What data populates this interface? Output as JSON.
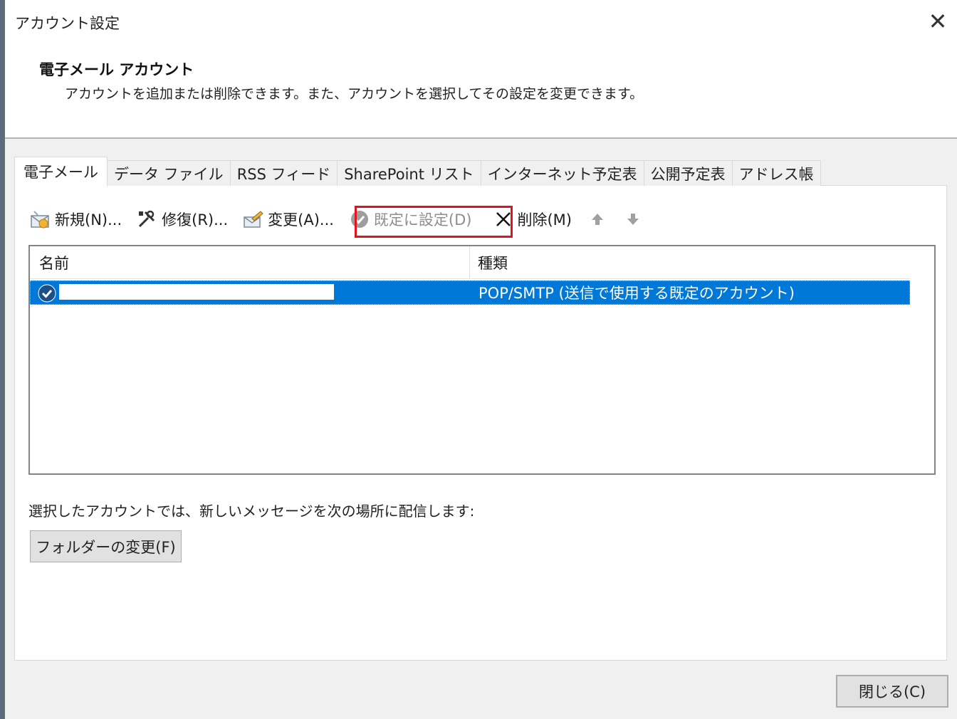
{
  "window": {
    "title": "アカウント設定",
    "close_glyph": "✕"
  },
  "header": {
    "title": "電子メール アカウント",
    "description": "アカウントを追加または削除できます。また、アカウントを選択してその設定を変更できます。"
  },
  "tabs": [
    {
      "label": "電子メール",
      "active": true
    },
    {
      "label": "データ ファイル"
    },
    {
      "label": "RSS フィード"
    },
    {
      "label": "SharePoint リスト"
    },
    {
      "label": "インターネット予定表"
    },
    {
      "label": "公開予定表"
    },
    {
      "label": "アドレス帳"
    }
  ],
  "toolbar": {
    "new_label": "新規(N)...",
    "repair_label": "修復(R)...",
    "change_label": "変更(A)...",
    "set_default_label": "既定に設定(D)",
    "delete_label": "削除(M)",
    "highlight_color": "#e0141e"
  },
  "list": {
    "col_name": "名前",
    "col_type": "種類",
    "rows": [
      {
        "type": "POP/SMTP (送信で使用する既定のアカウント)",
        "selected": true
      }
    ]
  },
  "deliver": {
    "text": "選択したアカウントでは、新しいメッセージを次の場所に配信します:",
    "folder_button": "フォルダーの変更(F)"
  },
  "footer": {
    "close_button": "閉じる(C)"
  },
  "colors": {
    "selection": "#0078d7",
    "window_bg": "#f0f0f0"
  }
}
